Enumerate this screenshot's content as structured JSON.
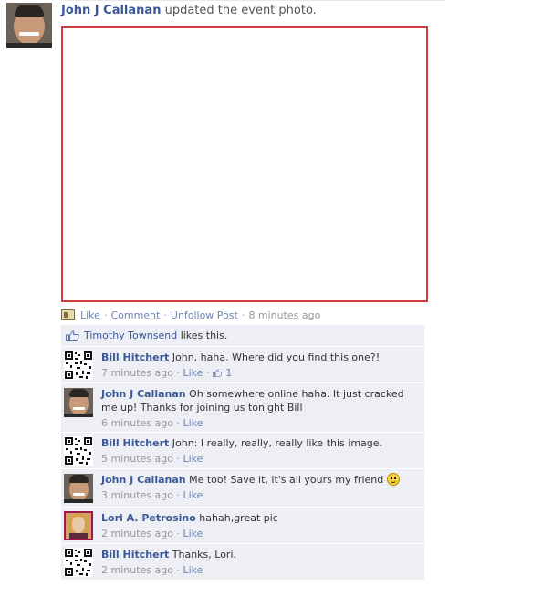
{
  "post": {
    "author": "John J Callanan",
    "action_text": "updated the event photo."
  },
  "actions": {
    "like": "Like",
    "comment": "Comment",
    "unfollow": "Unfollow Post",
    "time": "8 minutes ago"
  },
  "likes": {
    "name": "Timothy Townsend",
    "suffix": "likes this."
  },
  "comments": [
    {
      "author": "Bill Hitchert",
      "text": "John, haha. Where did you find this one?!",
      "time": "7 minutes ago",
      "like": "Like",
      "like_count": "1",
      "avatar": "qr-code"
    },
    {
      "author": "John J Callanan",
      "text": "Oh somewhere online haha. It just cracked me up! Thanks for joining us tonight Bill",
      "time": "6 minutes ago",
      "like": "Like",
      "avatar": "photo"
    },
    {
      "author": "Bill Hitchert",
      "text": "John: I really, really, really like this image.",
      "time": "5 minutes ago",
      "like": "Like",
      "avatar": "qr-code"
    },
    {
      "author": "John J Callanan",
      "text": "Me too! Save it, it's all yours my friend",
      "time": "3 minutes ago",
      "like": "Like",
      "avatar": "photo"
    },
    {
      "author": "Lori A. Petrosino",
      "text": "hahah,great pic",
      "time": "2 minutes ago",
      "like": "Like",
      "avatar": "photo"
    },
    {
      "author": "Bill Hitchert",
      "text": "Thanks, Lori.",
      "time": "2 minutes ago",
      "like": "Like",
      "avatar": "qr-code"
    }
  ],
  "colors": {
    "link": "#3b5998",
    "comment_bg": "#edeff4",
    "photo_border": "#d33a3a"
  },
  "icons": [
    "event-icon",
    "like-thumb-icon",
    "smiley-icon"
  ]
}
